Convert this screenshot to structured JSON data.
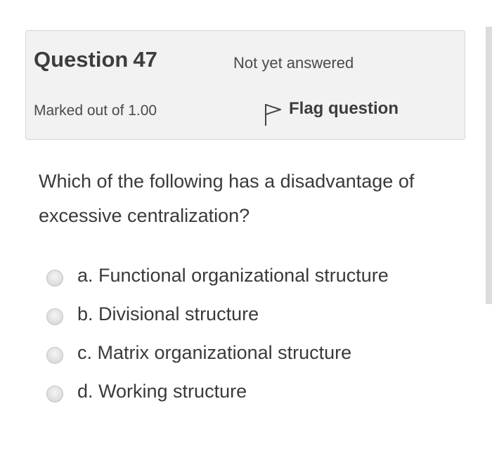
{
  "question": {
    "title_prefix": "Question",
    "number": "47",
    "state": "Not yet answered",
    "grade": "Marked out of 1.00",
    "flag_label": "Flag question",
    "flag_icon": "flag-icon",
    "text": "Which of the following has a disadvantage of excessive centralization?"
  },
  "answers": [
    {
      "label": "a. Functional organizational structure",
      "selected": false
    },
    {
      "label": "b. Divisional structure",
      "selected": false
    },
    {
      "label": "c. Matrix organizational structure",
      "selected": false
    },
    {
      "label": "d. Working structure",
      "selected": false
    }
  ],
  "colors": {
    "info_background": "#f2f2f2",
    "info_border": "#d6d6d6",
    "text": "#3a3a3a",
    "scrollbar": "#dcdcdc"
  }
}
